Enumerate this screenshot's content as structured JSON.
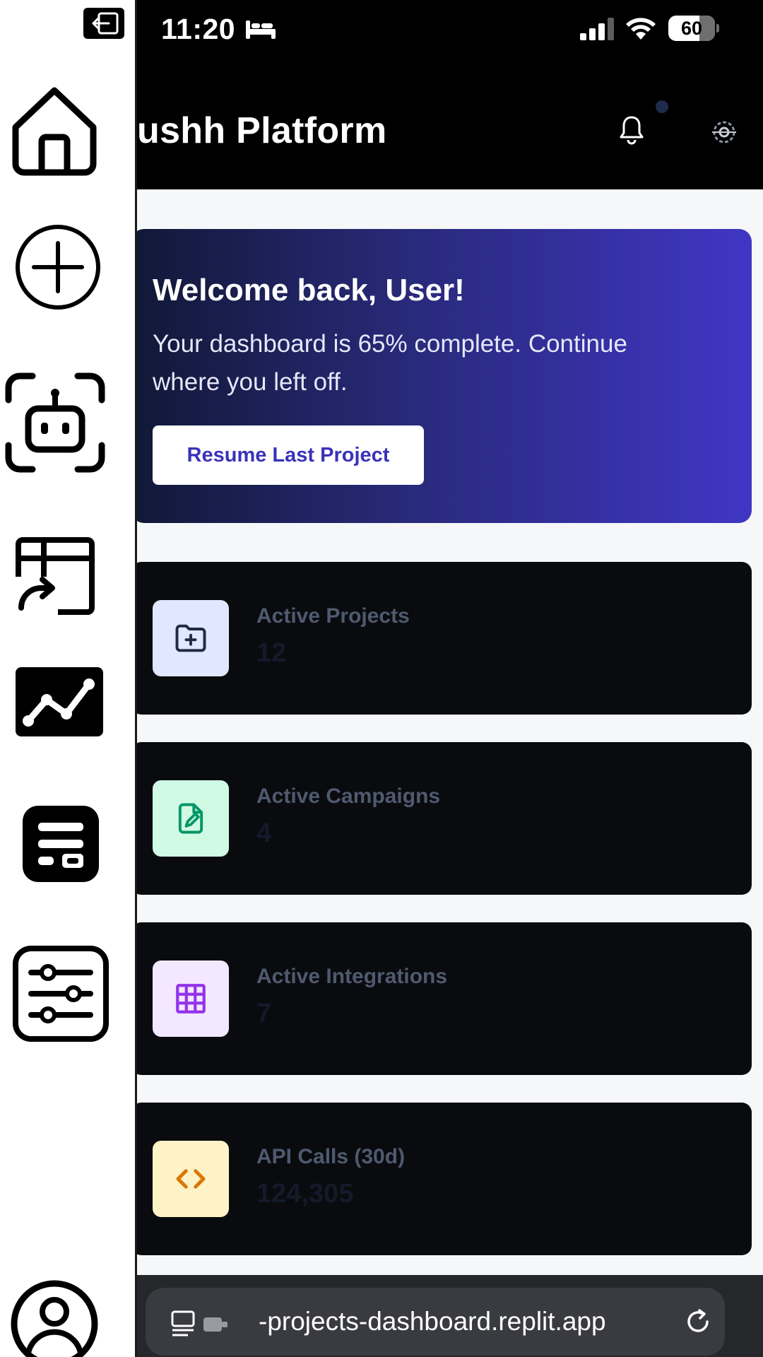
{
  "status_bar": {
    "time": "11:20",
    "battery_percent": "60"
  },
  "header": {
    "title": "ushh Platform",
    "notifications_icon": "bell-icon",
    "settings_icon": "gear-icon"
  },
  "welcome": {
    "title": "Welcome back, User!",
    "message": "Your dashboard is 65% complete. Continue where you left off.",
    "button_label": "Resume Last Project"
  },
  "stats": [
    {
      "label": "Active Projects",
      "value": "12",
      "icon": "folder-plus-icon",
      "icon_bg": "#e0e7ff",
      "icon_color": "#1f2a44"
    },
    {
      "label": "Active Campaigns",
      "value": "4",
      "icon": "file-edit-icon",
      "icon_bg": "#d1fae5",
      "icon_color": "#059669"
    },
    {
      "label": "Active Integrations",
      "value": "7",
      "icon": "grid-icon",
      "icon_bg": "#f3e8ff",
      "icon_color": "#9333ea"
    },
    {
      "label": "API Calls (30d)",
      "value": "124,305",
      "icon": "code-icon",
      "icon_bg": "#fef3c7",
      "icon_color": "#d97706"
    }
  ],
  "browser": {
    "url": "-projects-dashboard.replit.app"
  },
  "sidebar": {
    "items": [
      {
        "icon": "home-icon"
      },
      {
        "icon": "plus-circle-icon"
      },
      {
        "icon": "bot-icon"
      },
      {
        "icon": "deploy-icon"
      },
      {
        "icon": "analytics-icon"
      },
      {
        "icon": "dashboard-icon"
      },
      {
        "icon": "sliders-icon"
      },
      {
        "icon": "user-icon"
      }
    ]
  }
}
